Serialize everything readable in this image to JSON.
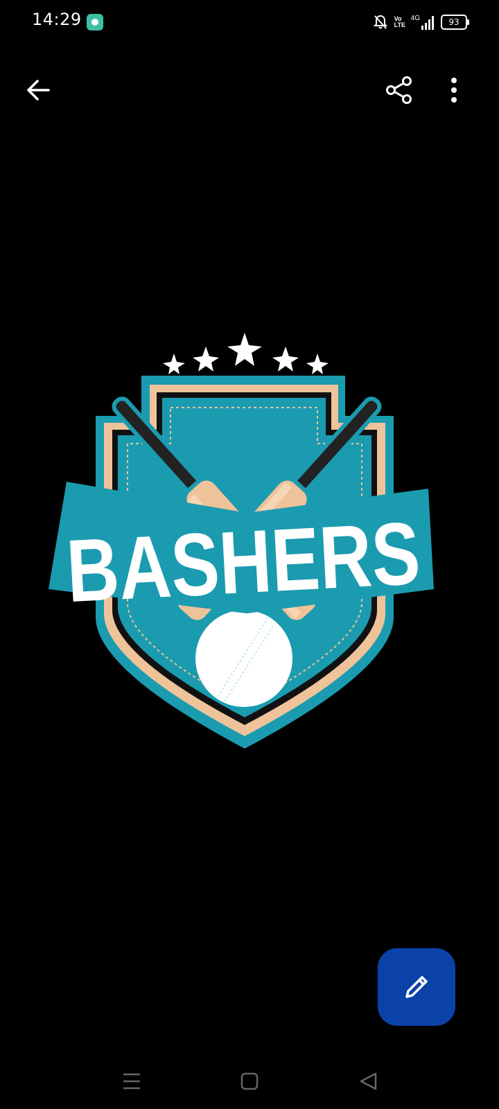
{
  "status_bar": {
    "time": "14:29",
    "network_label": "Vo LTE",
    "signal_label": "4G",
    "battery_level": "93",
    "icons": [
      "app-notification-icon",
      "bell-muted-icon",
      "volte-icon",
      "signal-4g-icon",
      "battery-icon"
    ]
  },
  "toolbar": {
    "icons": [
      "back-arrow-icon",
      "share-icon",
      "more-vert-icon"
    ]
  },
  "image": {
    "logo_text": "BASHERS",
    "colors": {
      "teal": "#1b9bb0",
      "peach": "#efc39a",
      "dark": "#111111",
      "white": "#ffffff"
    }
  },
  "fab": {
    "icon": "pencil-icon",
    "color": "#0b42a8"
  },
  "nav_bar": {
    "icons": [
      "recent-apps-icon",
      "home-icon",
      "back-triangle-icon"
    ]
  }
}
